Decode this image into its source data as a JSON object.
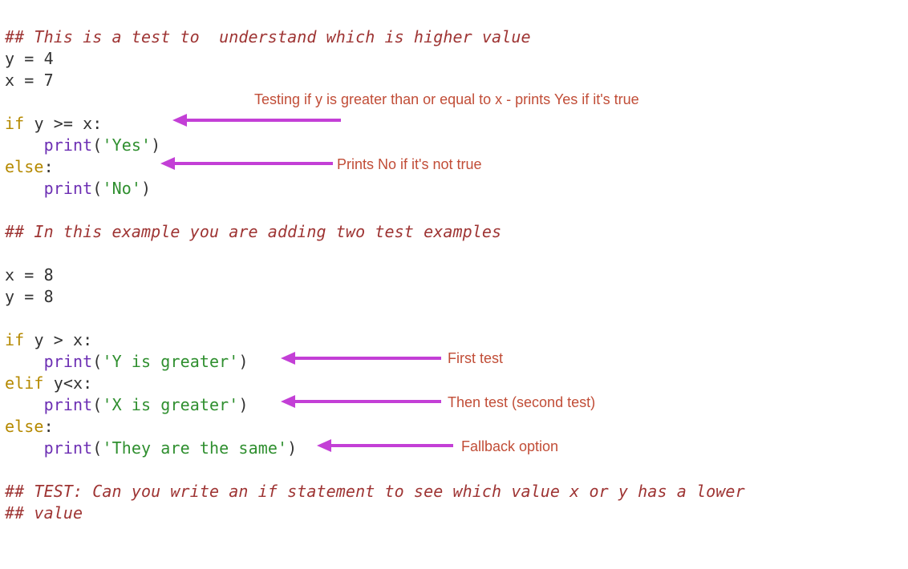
{
  "code": {
    "l1_comment": "## This is a test to  understand which is higher value",
    "l2_var": "y",
    "l2_eq": " = ",
    "l2_val": "4",
    "l3_var": "x",
    "l3_eq": " = ",
    "l3_val": "7",
    "l5_if": "if",
    "l5_expr": " y >= x:",
    "l6_indent": "    ",
    "l6_fn": "print",
    "l6_open": "(",
    "l6_str": "'Yes'",
    "l6_close": ")",
    "l7_else": "else",
    "l7_colon": ":",
    "l8_indent": "    ",
    "l8_fn": "print",
    "l8_open": "(",
    "l8_str": "'No'",
    "l8_close": ")",
    "l10_comment": "## In this example you are adding two test examples",
    "l12_var": "x",
    "l12_eq": " = ",
    "l12_val": "8",
    "l13_var": "y",
    "l13_eq": " = ",
    "l13_val": "8",
    "l15_if": "if",
    "l15_expr": " y > x:",
    "l16_indent": "    ",
    "l16_fn": "print",
    "l16_open": "(",
    "l16_str": "'Y is greater'",
    "l16_close": ")",
    "l17_elif": "elif",
    "l17_expr": " y<x:",
    "l18_indent": "    ",
    "l18_fn": "print",
    "l18_open": "(",
    "l18_str": "'X is greater'",
    "l18_close": ")",
    "l19_else": "else",
    "l19_colon": ":",
    "l20_indent": "    ",
    "l20_fn": "print",
    "l20_open": "(",
    "l20_str": "'They are the same'",
    "l20_close": ")",
    "l22_comment": "## TEST: Can you write an if statement to see which value x or y has a lower",
    "l23_comment": "## value"
  },
  "annotations": {
    "a1": "Testing if y is greater than or equal to x - prints Yes if it's true",
    "a2": "Prints No if it's not true",
    "a3": "First test",
    "a4": "Then test (second test)",
    "a5": "Fallback option"
  }
}
